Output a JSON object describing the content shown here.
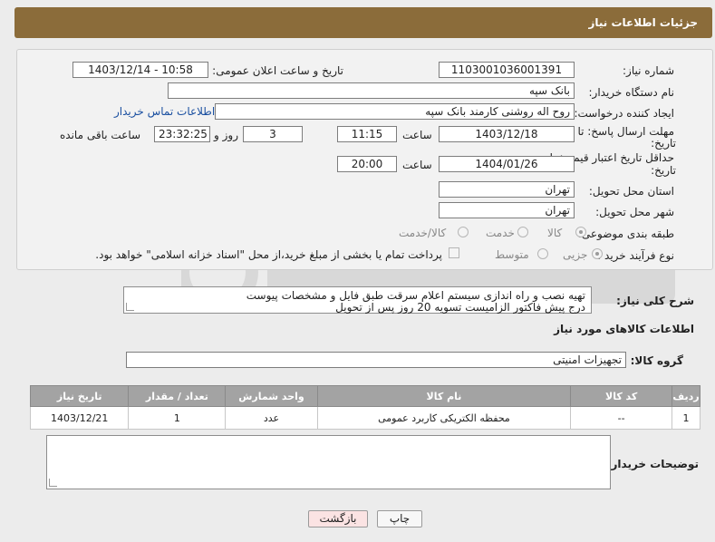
{
  "header": {
    "title": "جزئیات اطلاعات نیاز"
  },
  "form": {
    "need_number_label": "شماره نیاز:",
    "need_number": "1103001036001391",
    "announce_label": "تاریخ و ساعت اعلان عمومی:",
    "announce_value": "1403/12/14 - 10:58",
    "buyer_org_label": "نام دستگاه خریدار:",
    "buyer_org": "بانک سپه",
    "requester_label": "ایجاد کننده درخواست:",
    "requester": "روح اله روشنی کارمند بانک سپه",
    "contact_link": "اطلاعات تماس خریدار",
    "reply_deadline_label_1": "مهلت ارسال پاسخ: تا",
    "reply_deadline_label_2": "تاریخ:",
    "reply_date": "1403/12/18",
    "time_label": "ساعت",
    "reply_time": "11:15",
    "days_value": "3",
    "days_label": "روز و",
    "remaining_time": "23:32:25",
    "remaining_label": "ساعت باقی مانده",
    "price_validity_label_1": "حداقل تاریخ اعتبار قیمت: تا",
    "price_validity_label_2": "تاریخ:",
    "price_date": "1404/01/26",
    "price_time": "20:00",
    "province_label": "استان محل تحویل:",
    "province": "تهران",
    "city_label": "شهر محل تحویل:",
    "city": "تهران",
    "category_label": "طبقه بندی موضوعی:",
    "category_options": [
      "کالا",
      "خدمت",
      "کالا/خدمت"
    ],
    "category_selected": "کالا",
    "process_label": "نوع فرآیند خرید :",
    "process_options": [
      "جزیی",
      "متوسط"
    ],
    "process_selected": "جزیی",
    "payment_note": "پرداخت تمام یا بخشی از مبلغ خرید،از محل \"اسناد خزانه اسلامی\" خواهد بود."
  },
  "description": {
    "label": "شرح کلی نیاز:",
    "line1": "تهیه نصب و راه اندازی سیستم اعلام سرقت طبق فایل و مشخصات پیوست",
    "line2": "درج پیش فاکتور الزامیست تسویه 20 روز پس از تحویل"
  },
  "goods": {
    "section_title": "اطلاعات کالاهای مورد نیاز",
    "group_label": "گروه کالا:",
    "group_value": "تجهیزات امنیتی",
    "columns": [
      "ردیف",
      "کد کالا",
      "نام کالا",
      "واحد شمارش",
      "تعداد / مقدار",
      "تاریخ نیاز"
    ],
    "rows": [
      [
        "1",
        "--",
        "محفظه الکتریکی کاربرد عمومی",
        "عدد",
        "1",
        "1403/12/21"
      ]
    ]
  },
  "buyer_notes": {
    "label": "توضیحات خریدار:",
    "value": ""
  },
  "buttons": {
    "print": "چاپ",
    "back": "بازگشت"
  },
  "colors": {
    "header": "#8b6c3a",
    "table_header": "#a3a3a3",
    "back_button": "#fbe3e3"
  }
}
